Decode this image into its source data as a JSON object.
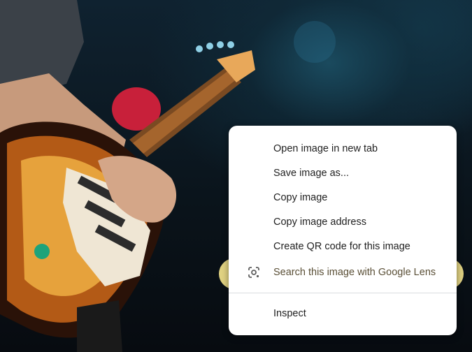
{
  "context_menu": {
    "items": [
      {
        "label": "Open image in new tab"
      },
      {
        "label": "Save image as..."
      },
      {
        "label": "Copy image"
      },
      {
        "label": "Copy image address"
      },
      {
        "label": "Create QR code for this image"
      },
      {
        "label": "Search this image with Google Lens",
        "icon": "google-lens-icon",
        "highlighted": true
      },
      {
        "label": "Inspect"
      }
    ],
    "highlight_color": "#f3e38c"
  }
}
